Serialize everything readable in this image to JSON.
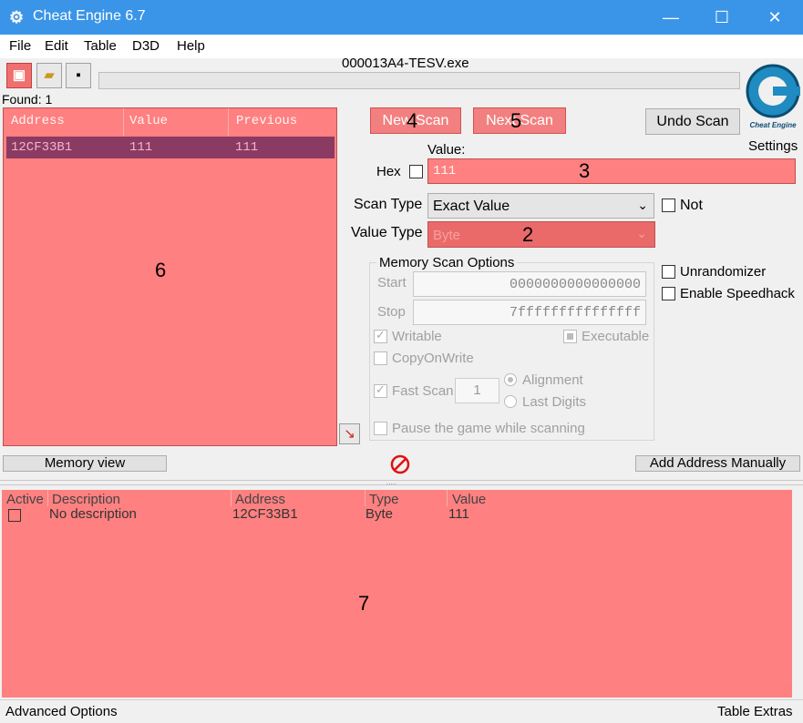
{
  "window": {
    "title": "Cheat Engine 6.7",
    "minimize_icon": "minimize-icon",
    "maximize_icon": "maximize-icon",
    "close_icon": "close-icon"
  },
  "menu": [
    "File",
    "Edit",
    "Table",
    "D3D",
    "Help"
  ],
  "process_name": "000013A4-TESV.exe",
  "found_label": "Found: 1",
  "found_list": {
    "columns": [
      "Address",
      "Value",
      "Previous"
    ],
    "rows": [
      {
        "address": "12CF33B1",
        "value": "111",
        "previous": "111"
      }
    ]
  },
  "buttons": {
    "new_scan": "New Scan",
    "next_scan": "Next Scan",
    "undo_scan": "Undo Scan",
    "memory_view": "Memory view",
    "add_address": "Add Address Manually"
  },
  "settings_label": "Settings",
  "logo_text": "Cheat Engine",
  "value_label": "Value:",
  "hex_label": "Hex",
  "value_input": "111",
  "scan_type_label": "Scan Type",
  "scan_type_value": "Exact Value",
  "not_label": "Not",
  "value_type_label": "Value Type",
  "value_type_value": "Byte",
  "memory_options": {
    "title": "Memory Scan Options",
    "start_label": "Start",
    "start_value": "0000000000000000",
    "stop_label": "Stop",
    "stop_value": "7fffffffffffffff",
    "writable": "Writable",
    "executable": "Executable",
    "copyonwrite": "CopyOnWrite",
    "fast_scan": "Fast Scan",
    "fast_scan_value": "1",
    "alignment": "Alignment",
    "last_digits": "Last Digits",
    "pause": "Pause the game while scanning"
  },
  "unrandomizer": "Unrandomizer",
  "speedhack": "Enable Speedhack",
  "address_list": {
    "columns": [
      "Active",
      "Description",
      "Address",
      "Type",
      "Value"
    ],
    "rows": [
      {
        "description": "No description",
        "address": "12CF33B1",
        "type": "Byte",
        "value": "111"
      }
    ]
  },
  "annotations": {
    "a2": "2",
    "a3": "3",
    "a4": "4",
    "a5": "5",
    "a6": "6",
    "a7": "7"
  },
  "status": {
    "left": "Advanced Options",
    "right": "Table Extras"
  },
  "colors": {
    "titlebar": "#3a95e8",
    "highlight": "#fe8080",
    "selected_row": "#8b3a63"
  }
}
